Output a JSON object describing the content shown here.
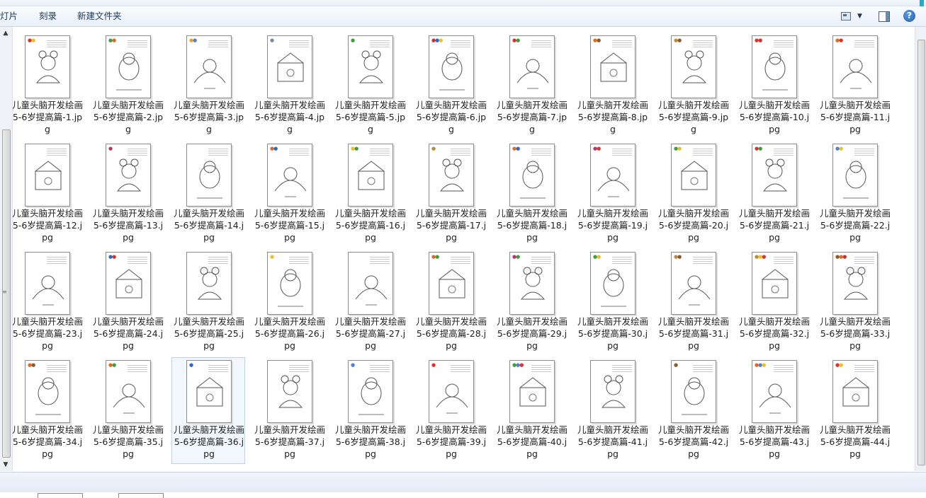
{
  "toolbar": {
    "left_items": [
      "灯片",
      "刻录",
      "新建文件夹"
    ]
  },
  "icons": {
    "view": "view-options-icon",
    "view_dropdown": "chevron-down-icon",
    "preview_pane": "preview-pane-icon",
    "help": "help-icon"
  },
  "help_glyph": "?",
  "files": [
    {
      "name": "儿童头脑开发绘画5-6岁提高篇-1.jpg",
      "swatches": [
        "#e0302a",
        "#f0c020"
      ]
    },
    {
      "name": "儿童头脑开发绘画5-6岁提高篇-2.jpg",
      "swatches": [
        "#3aa03a",
        "#e06a20"
      ]
    },
    {
      "name": "儿童头脑开发绘画5-6岁提高篇-3.jpg",
      "swatches": [
        "#f0a020",
        "#5080d0"
      ]
    },
    {
      "name": "儿童头脑开发绘画5-6岁提高篇-4.jpg",
      "swatches": [
        "#6a8fb0"
      ]
    },
    {
      "name": "儿童头脑开发绘画5-6岁提高篇-5.jpg",
      "swatches": [
        "#3aa03a"
      ]
    },
    {
      "name": "儿童头脑开发绘画5-6岁提高篇-6.jpg",
      "swatches": [
        "#d03030",
        "#2a6ad0",
        "#f0c020"
      ]
    },
    {
      "name": "儿童头脑开发绘画5-6岁提高篇-7.jpg",
      "swatches": [
        "#e0302a",
        "#3aa03a"
      ]
    },
    {
      "name": "儿童头脑开发绘画5-6岁提高篇-8.jpg",
      "swatches": [
        "#e06a20",
        "#8a5a2a"
      ]
    },
    {
      "name": "儿童头脑开发绘画5-6岁提高篇-9.jpg",
      "swatches": [
        "#c08a3a",
        "#8a5a2a"
      ]
    },
    {
      "name": "儿童头脑开发绘画5-6岁提高篇-10.jpg",
      "swatches": [
        "#e0302a",
        "#d03030"
      ]
    },
    {
      "name": "儿童头脑开发绘画5-6岁提高篇-11.jpg",
      "swatches": [
        "#e06a20",
        "#e0302a"
      ]
    },
    {
      "name": "儿童头脑开发绘画5-6岁提高篇-12.jpg",
      "swatches": []
    },
    {
      "name": "儿童头脑开发绘画5-6岁提高篇-13.jpg",
      "swatches": [
        "#c0306a"
      ]
    },
    {
      "name": "儿童头脑开发绘画5-6岁提高篇-14.jpg",
      "swatches": []
    },
    {
      "name": "儿童头脑开发绘画5-6岁提高篇-15.jpg",
      "swatches": [
        "#e06a20",
        "#2a6ad0"
      ]
    },
    {
      "name": "儿童头脑开发绘画5-6岁提高篇-16.jpg",
      "swatches": [
        "#f0c020",
        "#3aa03a"
      ]
    },
    {
      "name": "儿童头脑开发绘画5-6岁提高篇-17.jpg",
      "swatches": [
        "#c08a3a"
      ]
    },
    {
      "name": "儿童头脑开发绘画5-6岁提高篇-18.jpg",
      "swatches": [
        "#e06a20",
        "#2a6ad0"
      ]
    },
    {
      "name": "儿童头脑开发绘画5-6岁提高篇-19.jpg",
      "swatches": [
        "#c0306a",
        "#e0302a"
      ]
    },
    {
      "name": "儿童头脑开发绘画5-6岁提高篇-20.jpg",
      "swatches": [
        "#3aa03a",
        "#f0c020"
      ]
    },
    {
      "name": "儿童头脑开发绘画5-6岁提高篇-21.jpg",
      "swatches": [
        "#e0302a",
        "#3aa03a"
      ]
    },
    {
      "name": "儿童头脑开发绘画5-6岁提高篇-22.jpg",
      "swatches": [
        "#5080d0",
        "#f0c020"
      ]
    },
    {
      "name": "儿童头脑开发绘画5-6岁提高篇-23.jpg",
      "swatches": []
    },
    {
      "name": "儿童头脑开发绘画5-6岁提高篇-24.jpg",
      "swatches": [
        "#2a6ad0",
        "#e0302a"
      ]
    },
    {
      "name": "儿童头脑开发绘画5-6岁提高篇-25.jpg",
      "swatches": []
    },
    {
      "name": "儿童头脑开发绘画5-6岁提高篇-26.jpg",
      "swatches": [
        "#f0c020"
      ]
    },
    {
      "name": "儿童头脑开发绘画5-6岁提高篇-27.jpg",
      "swatches": []
    },
    {
      "name": "儿童头脑开发绘画5-6岁提高篇-28.jpg",
      "swatches": [
        "#e06a20",
        "#3aa03a"
      ]
    },
    {
      "name": "儿童头脑开发绘画5-6岁提高篇-29.jpg",
      "swatches": [
        "#c0306a",
        "#3aa03a"
      ]
    },
    {
      "name": "儿童头脑开发绘画5-6岁提高篇-30.jpg",
      "swatches": [
        "#3aa03a",
        "#f0c020"
      ]
    },
    {
      "name": "儿童头脑开发绘画5-6岁提高篇-31.jpg",
      "swatches": [
        "#c08a3a",
        "#8a5a2a"
      ]
    },
    {
      "name": "儿童头脑开发绘画5-6岁提高篇-32.jpg",
      "swatches": [
        "#c08a3a",
        "#f0c020",
        "#e0302a"
      ]
    },
    {
      "name": "儿童头脑开发绘画5-6岁提高篇-33.jpg",
      "swatches": [
        "#8a5a2a",
        "#e06a20",
        "#d03030"
      ]
    },
    {
      "name": "儿童头脑开发绘画5-6岁提高篇-34.jpg",
      "swatches": [
        "#e06a20",
        "#8a5a2a"
      ]
    },
    {
      "name": "儿童头脑开发绘画5-6岁提高篇-35.jpg",
      "swatches": [
        "#e06a20",
        "#3aa03a"
      ]
    },
    {
      "name": "儿童头脑开发绘画5-6岁提高篇-36.jpg",
      "swatches": [
        "#2a6ad0"
      ],
      "selected": true
    },
    {
      "name": "儿童头脑开发绘画5-6岁提高篇-37.jpg",
      "swatches": []
    },
    {
      "name": "儿童头脑开发绘画5-6岁提高篇-38.jpg",
      "swatches": [
        "#5080d0"
      ]
    },
    {
      "name": "儿童头脑开发绘画5-6岁提高篇-39.jpg",
      "swatches": [
        "#e0302a"
      ]
    },
    {
      "name": "儿童头脑开发绘画5-6岁提高篇-40.jpg",
      "swatches": [
        "#3aa03a",
        "#5080d0",
        "#e0302a"
      ]
    },
    {
      "name": "儿童头脑开发绘画5-6岁提高篇-41.jpg",
      "swatches": []
    },
    {
      "name": "儿童头脑开发绘画5-6岁提高篇-42.jpg",
      "swatches": [
        "#8a5a2a"
      ]
    },
    {
      "name": "儿童头脑开发绘画5-6岁提高篇-43.jpg",
      "swatches": [
        "#e06a20",
        "#5080d0",
        "#f0c020"
      ]
    },
    {
      "name": "儿童头脑开发绘画5-6岁提高篇-44.jpg",
      "swatches": [
        "#e0302a",
        "#f0c020"
      ]
    }
  ],
  "colors": {
    "selection_bg": "#f2f7fd",
    "selection_border": "#b8d4f0",
    "toolbar_text": "#1e395b"
  }
}
